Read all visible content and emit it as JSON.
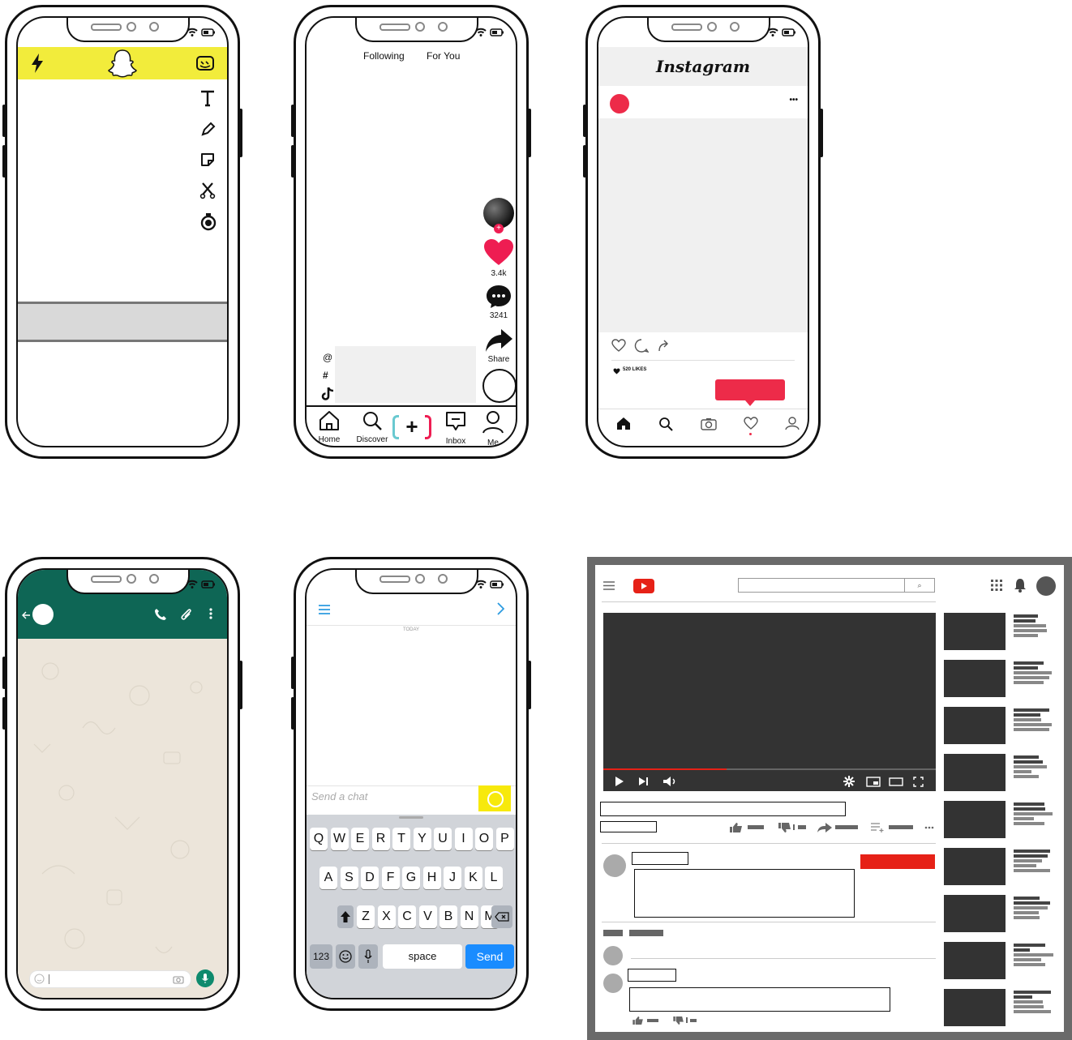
{
  "tiktok": {
    "tab_following": "Following",
    "tab_for_you": "For You",
    "likes": "3.4k",
    "comments": "3241",
    "share": "Share",
    "at": "@",
    "hash": "#",
    "nav_home": "Home",
    "nav_discover": "Discover",
    "nav_inbox": "Inbox",
    "nav_me": "Me",
    "create_label": "+"
  },
  "instagram": {
    "logo": "Instagram",
    "more": "•••",
    "likes": "520 LIKES"
  },
  "snapchat_chat": {
    "date": "TODAY",
    "placeholder": "Send a chat",
    "keys_row1": [
      "Q",
      "W",
      "E",
      "R",
      "T",
      "Y",
      "U",
      "I",
      "O",
      "P"
    ],
    "keys_row2": [
      "A",
      "S",
      "D",
      "F",
      "G",
      "H",
      "J",
      "K",
      "L"
    ],
    "keys_row3": [
      "Z",
      "X",
      "C",
      "V",
      "B",
      "N",
      "M"
    ],
    "key_123": "123",
    "key_space": "space",
    "key_send": "Send"
  },
  "youtube": {
    "search_icon": "⌕"
  },
  "colors": {
    "snap_yellow": "#f2ec3b",
    "tiktok_red": "#ee1d52",
    "tiktok_cyan": "#69c9d0",
    "instagram_red": "#ed2b49",
    "whatsapp_green": "#0e6655",
    "send_blue": "#1a8cff",
    "youtube_red": "#e62117"
  }
}
